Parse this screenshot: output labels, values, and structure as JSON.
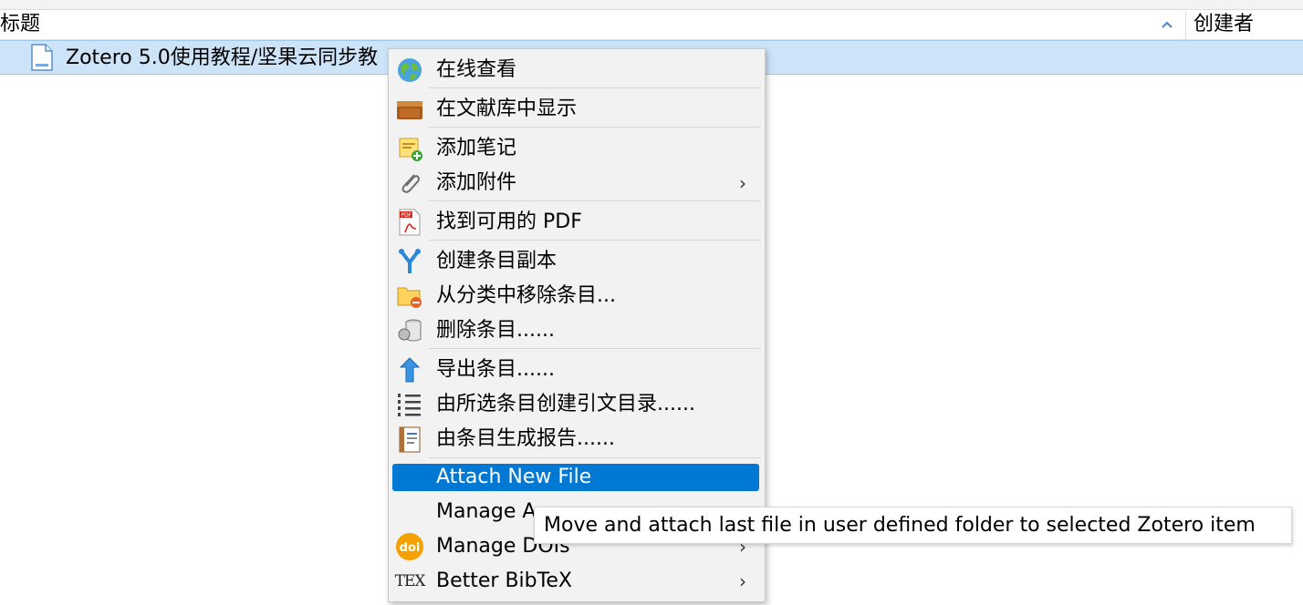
{
  "header": {
    "title_col": "标题",
    "creator_col": "创建者",
    "sort_icon": "sort-ascending-icon"
  },
  "item": {
    "title": "Zotero 5.0使用教程/坚果云同步教",
    "icon": "document-icon"
  },
  "context_menu": {
    "items": [
      {
        "label": "在线查看",
        "icon": "globe-icon"
      },
      {
        "label": "在文献库中显示",
        "icon": "library-box-icon"
      },
      {
        "label": "添加笔记",
        "icon": "add-note-icon"
      },
      {
        "label": "添加附件",
        "icon": "paperclip-icon",
        "submenu": "›"
      },
      {
        "label": "找到可用的 PDF",
        "icon": "pdf-icon"
      },
      {
        "label": "创建条目副本",
        "icon": "duplicate-icon"
      },
      {
        "label": "从分类中移除条目...",
        "icon": "remove-from-collection-icon"
      },
      {
        "label": "删除条目......",
        "icon": "trash-icon"
      },
      {
        "label": "导出条目......",
        "icon": "export-arrow-icon"
      },
      {
        "label": "由所选条目创建引文目录......",
        "icon": "bibliography-list-icon"
      },
      {
        "label": "由条目生成报告......",
        "icon": "report-icon"
      },
      {
        "label": "Attach New File",
        "icon": ""
      },
      {
        "label": "Manage A",
        "icon": "",
        "submenu": "›"
      },
      {
        "label": "Manage DOIs",
        "icon": "doi-icon",
        "submenu": "›"
      },
      {
        "label": "Better BibTeX",
        "icon": "tex-icon",
        "submenu": "›"
      }
    ],
    "doi_text": "doi",
    "tex_text": "TEX"
  },
  "tooltip": {
    "text": "Move and attach last file in user defined folder to selected Zotero item"
  },
  "colors": {
    "selection": "#cde3f8",
    "menu_highlight": "#0078d4",
    "menu_bg": "#f2f2f2",
    "doi_orange": "#f4a100"
  }
}
